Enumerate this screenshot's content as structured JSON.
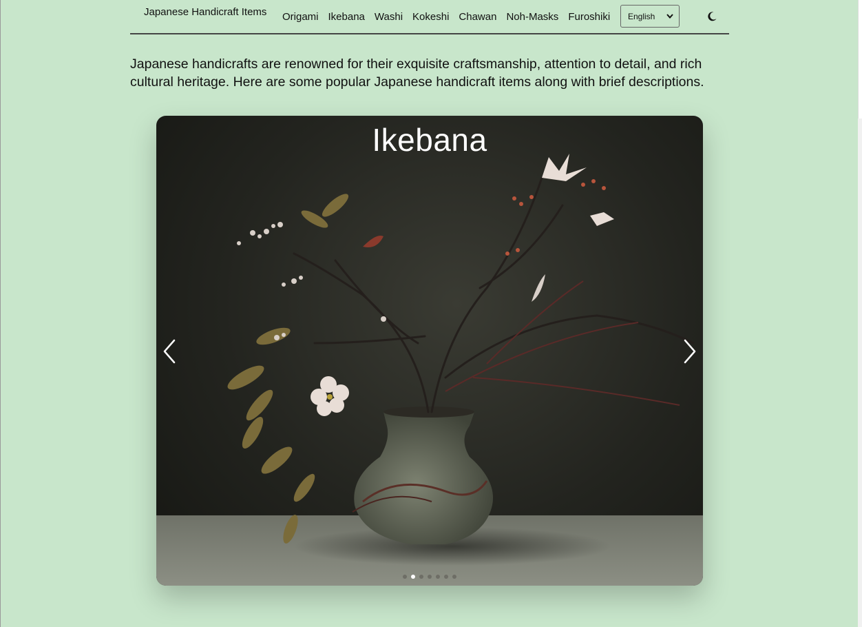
{
  "header": {
    "brand": "Japanese Handicraft Items",
    "nav": [
      "Origami",
      "Ikebana",
      "Washi",
      "Kokeshi",
      "Chawan",
      "Noh-Masks",
      "Furoshiki"
    ],
    "language": "English",
    "theme_icon": "moon-icon"
  },
  "intro": "Japanese handicrafts are renowned for their exquisite craftsmanship, attention to detail, and rich cultural heritage. Here are some popular Japanese handicraft items along with brief descriptions.",
  "carousel": {
    "title": "Ikebana",
    "active_index": 1,
    "slide_count": 7
  },
  "colors": {
    "background": "#c8e6cb",
    "text": "#111111",
    "slide_title": "#ffffff"
  }
}
